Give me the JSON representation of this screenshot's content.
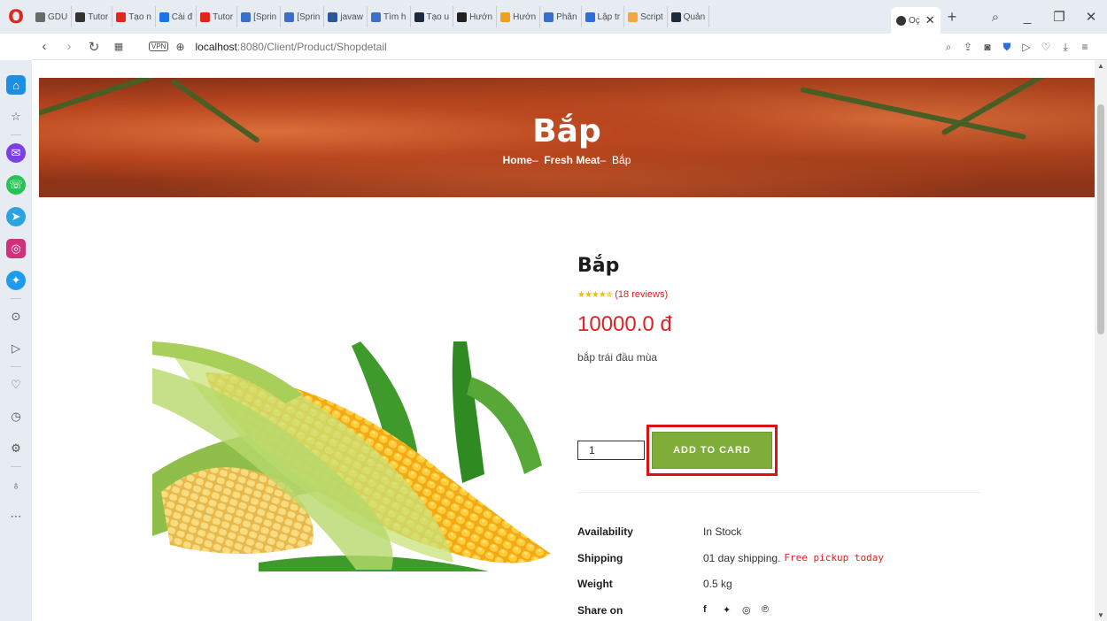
{
  "browser": {
    "tabs": [
      {
        "label": "GDU",
        "color": "#6a6a6a"
      },
      {
        "label": "Tutor",
        "color": "#333333"
      },
      {
        "label": "Tạo n",
        "color": "#e2261a"
      },
      {
        "label": "Cài đ",
        "color": "#1a73e8"
      },
      {
        "label": "Tutor",
        "color": "#e2261a"
      },
      {
        "label": "[Sprin",
        "color": "#3a70c9"
      },
      {
        "label": "[Sprin",
        "color": "#3a70c9"
      },
      {
        "label": "javaw",
        "color": "#2b579a"
      },
      {
        "label": "Tìm h",
        "color": "#3a70c9"
      },
      {
        "label": "Tạo u",
        "color": "#1d2a3a"
      },
      {
        "label": "Hướn",
        "color": "#222222"
      },
      {
        "label": "Hướn",
        "color": "#f0a020"
      },
      {
        "label": "Phân",
        "color": "#3a70c9"
      },
      {
        "label": "Lập tr",
        "color": "#2d6fd6"
      },
      {
        "label": "Script",
        "color": "#f2a541"
      },
      {
        "label": "Quản",
        "color": "#1d2a3a"
      }
    ],
    "active_tab": "Oç",
    "url_host": "localhost",
    "url_rest": ":8080/Client/Product/Shopdetail",
    "vpn_label": "VPN"
  },
  "hero": {
    "title": "Bắp",
    "crumb_home": "Home",
    "crumb_category": "Fresh Meat",
    "crumb_current": "Bắp",
    "sep": "–"
  },
  "product": {
    "title": "Bắp",
    "stars": "★★★★✯",
    "reviews": "(18 reviews)",
    "price": "10000.0 đ",
    "description": "bắp trái đầu mùa",
    "quantity": "1",
    "add_label": "ADD TO CARD",
    "specs": [
      {
        "label": "Availability",
        "value": "In Stock"
      },
      {
        "label": "Shipping",
        "value": "01 day shipping.",
        "extra": "Free pickup today"
      },
      {
        "label": "Weight",
        "value": "0.5 kg"
      },
      {
        "label": "Share on",
        "value": ""
      }
    ]
  }
}
